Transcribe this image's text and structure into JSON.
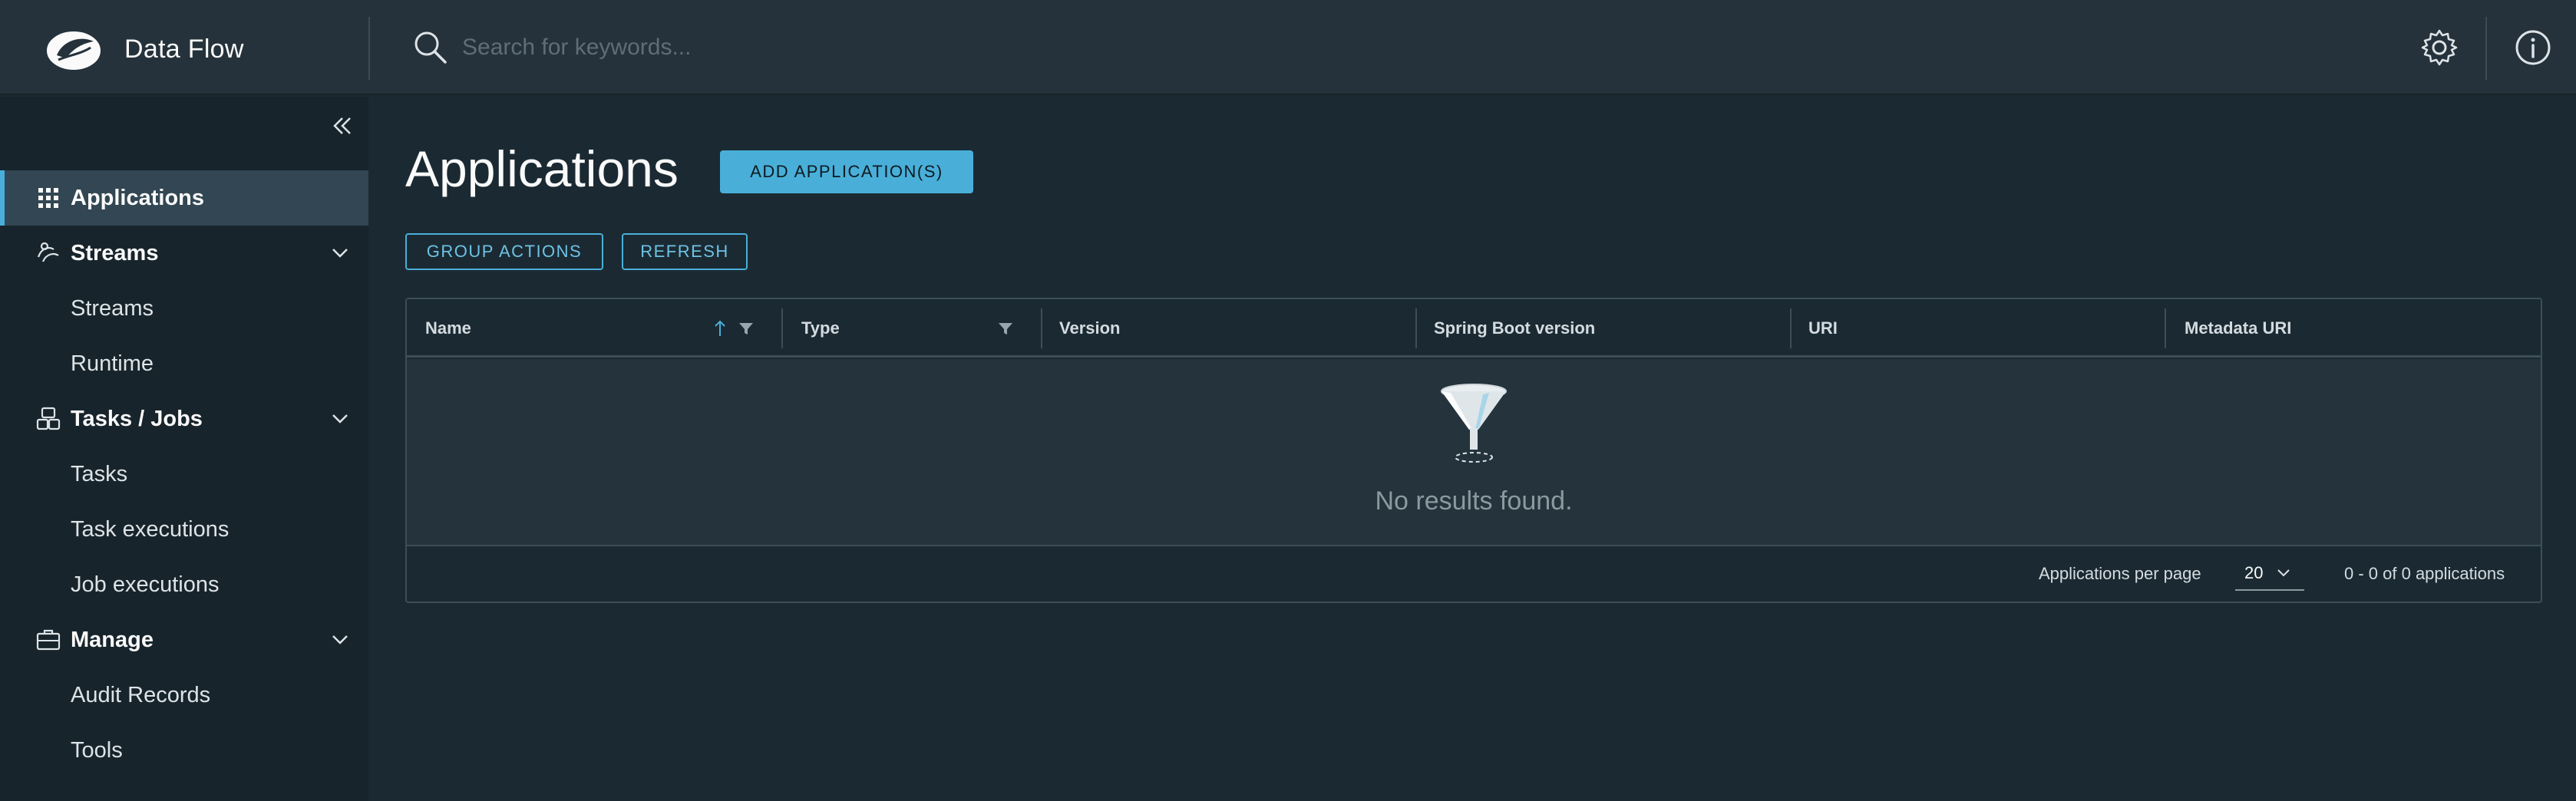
{
  "app": {
    "title": "Data Flow"
  },
  "search": {
    "placeholder": "Search for keywords..."
  },
  "header_icons": [
    "settings-gear-icon",
    "info-icon"
  ],
  "sidebar": {
    "items": [
      {
        "label": "Applications",
        "icon": "grid-icon",
        "active": true
      },
      {
        "label": "Streams",
        "icon": "streams-icon",
        "expanded": true,
        "children": [
          {
            "label": "Streams"
          },
          {
            "label": "Runtime"
          }
        ]
      },
      {
        "label": "Tasks / Jobs",
        "icon": "tasks-icon",
        "expanded": true,
        "children": [
          {
            "label": "Tasks"
          },
          {
            "label": "Task executions"
          },
          {
            "label": "Job executions"
          }
        ]
      },
      {
        "label": "Manage",
        "icon": "briefcase-icon",
        "expanded": true,
        "children": [
          {
            "label": "Audit Records"
          },
          {
            "label": "Tools"
          }
        ]
      }
    ]
  },
  "main": {
    "title": "Applications",
    "add_button": "ADD APPLICATION(S)",
    "group_actions_button": "GROUP ACTIONS",
    "refresh_button": "REFRESH"
  },
  "table": {
    "columns": [
      "Name",
      "Type",
      "Version",
      "Spring Boot version",
      "URI",
      "Metadata URI"
    ],
    "empty_text": "No results found.",
    "footer": {
      "per_page_label": "Applications per page",
      "per_page_value": "20",
      "range_text": "0 - 0 of 0 applications"
    }
  },
  "colors": {
    "accent": "#49afd9",
    "header_bg": "#25323b",
    "sidebar_bg": "#17242b",
    "main_bg": "#1b2a32"
  }
}
